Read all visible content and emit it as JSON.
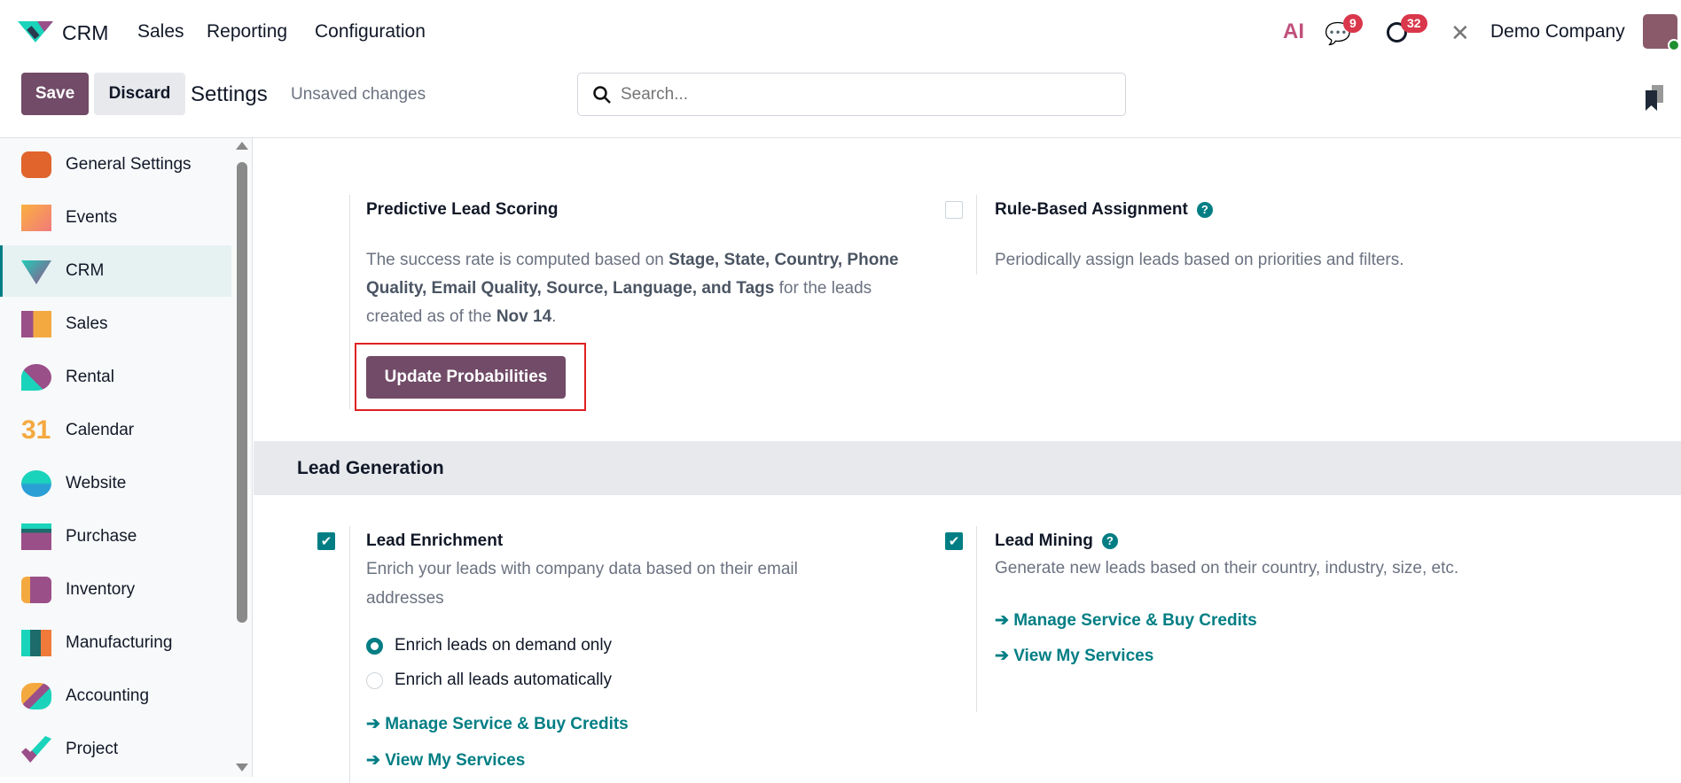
{
  "nav": {
    "app": "CRM",
    "menu": [
      "Sales",
      "Reporting",
      "Configuration"
    ],
    "messages_count": "9",
    "activities_count": "32",
    "company": "Demo Company",
    "ai_label": "AI"
  },
  "control": {
    "save": "Save",
    "discard": "Discard",
    "title": "Settings",
    "status": "Unsaved changes",
    "search_placeholder": "Search..."
  },
  "sidebar": {
    "items": [
      {
        "label": "General Settings"
      },
      {
        "label": "Events"
      },
      {
        "label": "CRM"
      },
      {
        "label": "Sales"
      },
      {
        "label": "Rental"
      },
      {
        "label": "Calendar"
      },
      {
        "label": "Website"
      },
      {
        "label": "Purchase"
      },
      {
        "label": "Inventory"
      },
      {
        "label": "Manufacturing"
      },
      {
        "label": "Accounting"
      },
      {
        "label": "Project"
      }
    ],
    "active": "CRM",
    "calendar_icon_text": "31"
  },
  "settings": {
    "pls": {
      "title": "Predictive Lead Scoring",
      "d1": "The success rate is computed based on ",
      "fields": "Stage, State, Country, Phone Quality, Email Quality, Source, Language, and Tags",
      "d2": " for the leads created as of the ",
      "date": "Nov 14",
      "d3": ".",
      "button": "Update Probabilities"
    },
    "rba": {
      "title": "Rule-Based Assignment",
      "desc": "Periodically assign leads based on priorities and filters.",
      "checked": false
    },
    "section": "Lead Generation",
    "enrich": {
      "title": "Lead Enrichment",
      "desc": "Enrich your leads with company data based on their email addresses",
      "checked": true,
      "options": [
        "Enrich leads on demand only",
        "Enrich all leads automatically"
      ],
      "selected": 0,
      "links": [
        "Manage Service & Buy Credits",
        "View My Services"
      ]
    },
    "mining": {
      "title": "Lead Mining",
      "desc": "Generate new leads based on their country, industry, size, etc.",
      "checked": true,
      "links": [
        "Manage Service & Buy Credits",
        "View My Services"
      ]
    }
  },
  "colors": {
    "primary": "#714B67",
    "teal": "#017e84",
    "badge": "#d9374b",
    "highlight": "#e02020"
  }
}
